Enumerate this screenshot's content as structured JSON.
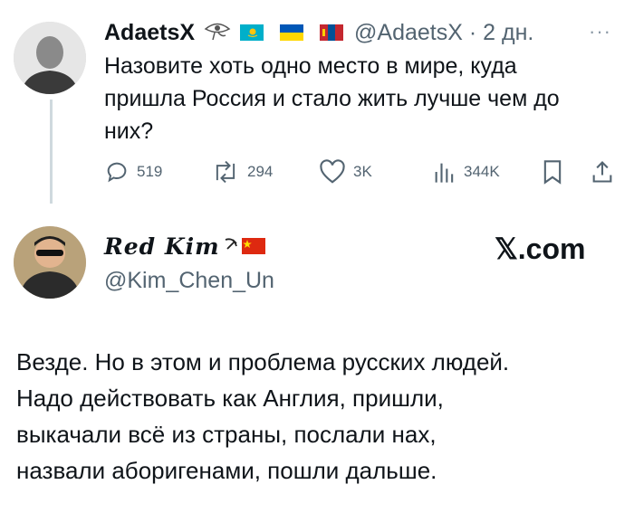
{
  "post": {
    "author_name": "AdaetsX",
    "handle_time": "@AdaetsX · 2 дн.",
    "more": "···",
    "text_line1": "Назовите хоть одно место в мире, куда",
    "text_line2": "пришла Россия и стало жить лучше чем до",
    "text_line3": "них?",
    "actions": {
      "replies": "519",
      "reposts": "294",
      "likes": "3K",
      "views": "344K"
    },
    "flags": [
      "kazakhstan-flag",
      "ukraine-flag",
      "mongolia-flag"
    ],
    "badge_icon": "eye-of-horus-icon"
  },
  "reply": {
    "author_name": "Red Kim",
    "handle": "@Kim_Chen_Un",
    "watermark": "𝕏.com",
    "text_line1": "Везде. Но в этом и проблема русских людей.",
    "text_line2": "Надо действовать как Англия, пришли,",
    "text_line3": "выкачали всё из страны, послали нах,",
    "text_line4": "назвали аборигенами, пошли дальше."
  },
  "colors": {
    "text": "#0f1419",
    "secondary": "#536471",
    "thread_line": "#cfd9de"
  }
}
